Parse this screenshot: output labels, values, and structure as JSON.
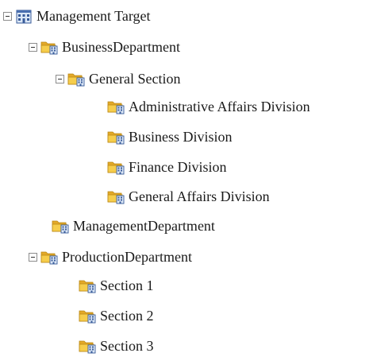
{
  "tree": {
    "root": {
      "label": "Management Target",
      "icon": "building-icon",
      "expanded": true
    },
    "business": {
      "label": "BusinessDepartment",
      "icon": "folder-building-icon",
      "expanded": true
    },
    "general_section": {
      "label": "General Section",
      "icon": "folder-building-icon",
      "expanded": true
    },
    "admin_affairs": {
      "label": "Administrative Affairs Division",
      "icon": "folder-building-icon"
    },
    "business_division": {
      "label": "Business Division",
      "icon": "folder-building-icon"
    },
    "finance_division": {
      "label": "Finance Division",
      "icon": "folder-building-icon"
    },
    "general_affairs": {
      "label": "General Affairs Division",
      "icon": "folder-building-icon"
    },
    "management": {
      "label": "ManagementDepartment",
      "icon": "folder-building-icon"
    },
    "production": {
      "label": "ProductionDepartment",
      "icon": "folder-building-icon",
      "expanded": true
    },
    "section1": {
      "label": "Section 1",
      "icon": "folder-building-icon"
    },
    "section2": {
      "label": "Section 2",
      "icon": "folder-building-icon"
    },
    "section3": {
      "label": "Section 3",
      "icon": "folder-building-icon"
    }
  },
  "colors": {
    "folder": "#f0c23c",
    "folder_dark": "#c9951a",
    "building": "#4a6fb0",
    "building_light": "#cfe0f5"
  }
}
